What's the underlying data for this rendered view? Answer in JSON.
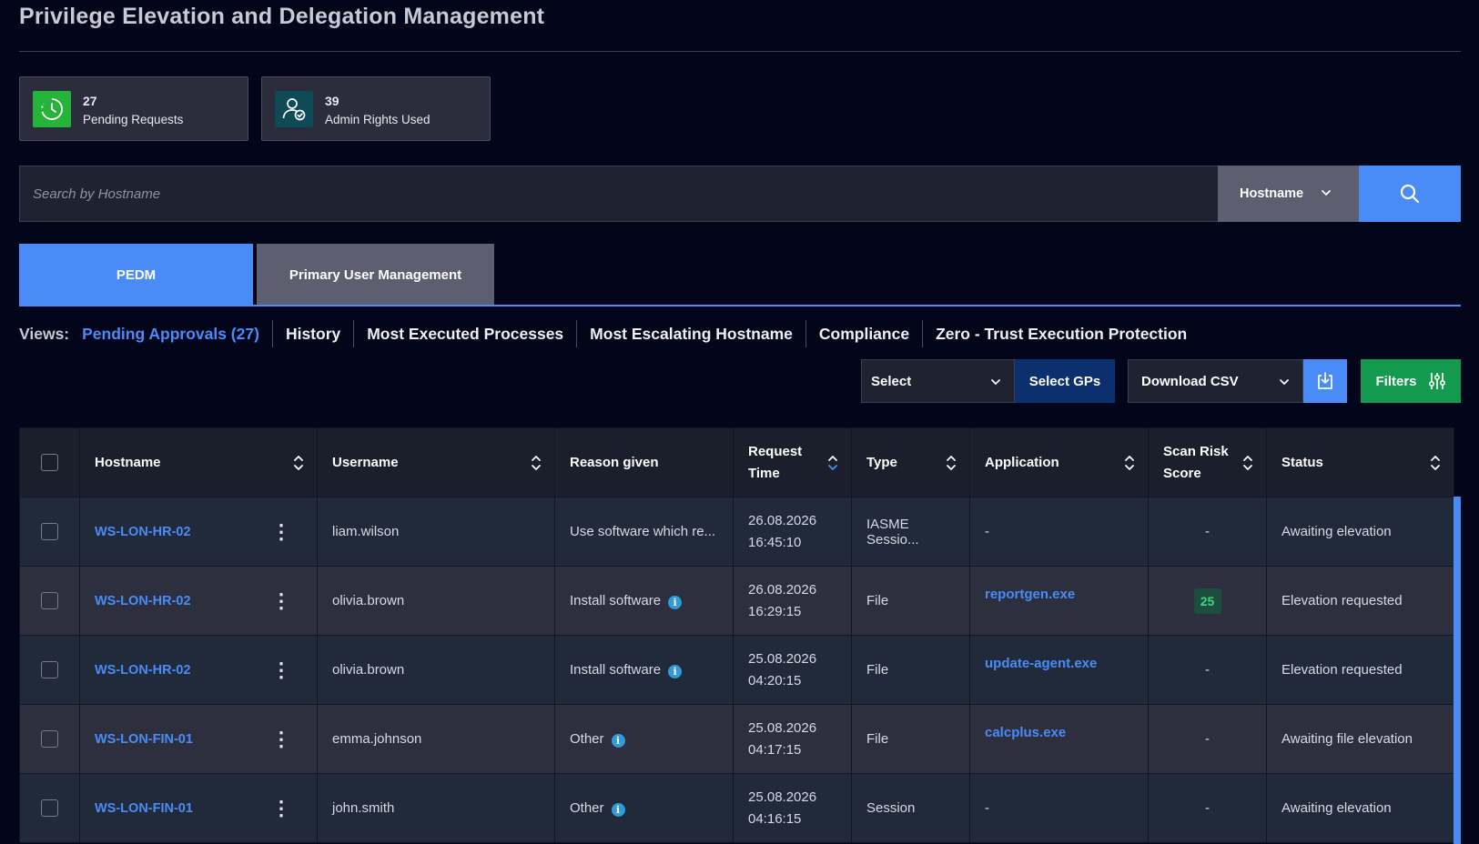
{
  "page": {
    "title": "Privilege Elevation and Delegation Management"
  },
  "stats": [
    {
      "value": "27",
      "label": "Pending Requests",
      "icon": "clock-icon",
      "color": "#25b33a"
    },
    {
      "value": "39",
      "label": "Admin Rights Used",
      "icon": "user-shield-icon",
      "color": "#0f4a57"
    }
  ],
  "search": {
    "placeholder": "Search by Hostname",
    "field": "Hostname"
  },
  "tabs": [
    {
      "label": "PEDM",
      "active": true
    },
    {
      "label": "Primary User Management",
      "active": false
    }
  ],
  "views": {
    "label": "Views:",
    "items": [
      "Pending Approvals (27)",
      "History",
      "Most Executed Processes",
      "Most Escalating Hostname",
      "Compliance",
      "Zero - Trust Execution Protection"
    ],
    "active_index": 0
  },
  "toolbar": {
    "select_label": "Select",
    "select_gps_label": "Select GPs",
    "download_label": "Download CSV",
    "filters_label": "Filters"
  },
  "table": {
    "columns": [
      "Hostname",
      "Username",
      "Reason given",
      "Request Time",
      "Type",
      "Application",
      "Scan Risk Score",
      "Status"
    ],
    "rows": [
      {
        "hostname": "WS-LON-HR-02",
        "username": "liam.wilson",
        "reason": "Use software which re...",
        "reason_info": false,
        "date": "26.08.2026",
        "time": "16:45:10",
        "type": "IASME Sessio...",
        "application": "-",
        "app_link": false,
        "risk": "-",
        "status": "Awaiting elevation"
      },
      {
        "hostname": "WS-LON-HR-02",
        "username": "olivia.brown",
        "reason": "Install software",
        "reason_info": true,
        "date": "26.08.2026",
        "time": "16:29:15",
        "type": "File",
        "application": "reportgen.exe",
        "app_link": true,
        "risk": "25",
        "status": "Elevation requested"
      },
      {
        "hostname": "WS-LON-HR-02",
        "username": "olivia.brown",
        "reason": "Install software",
        "reason_info": true,
        "date": "25.08.2026",
        "time": "04:20:15",
        "type": "File",
        "application": "update-agent.exe",
        "app_link": true,
        "risk": "-",
        "status": "Elevation requested"
      },
      {
        "hostname": "WS-LON-FIN-01",
        "username": "emma.johnson",
        "reason": "Other",
        "reason_info": true,
        "date": "25.08.2026",
        "time": "04:17:15",
        "type": "File",
        "application": "calcplus.exe",
        "app_link": true,
        "risk": "-",
        "status": "Awaiting file elevation"
      },
      {
        "hostname": "WS-LON-FIN-01",
        "username": "john.smith",
        "reason": "Other",
        "reason_info": true,
        "date": "25.08.2026",
        "time": "04:16:15",
        "type": "Session",
        "application": "-",
        "app_link": false,
        "risk": "-",
        "status": "Awaiting elevation"
      }
    ]
  },
  "colors": {
    "accent": "#4a8cf7",
    "success": "#139a4e",
    "background": "#03051a",
    "risk_badge": "#3bd683"
  }
}
